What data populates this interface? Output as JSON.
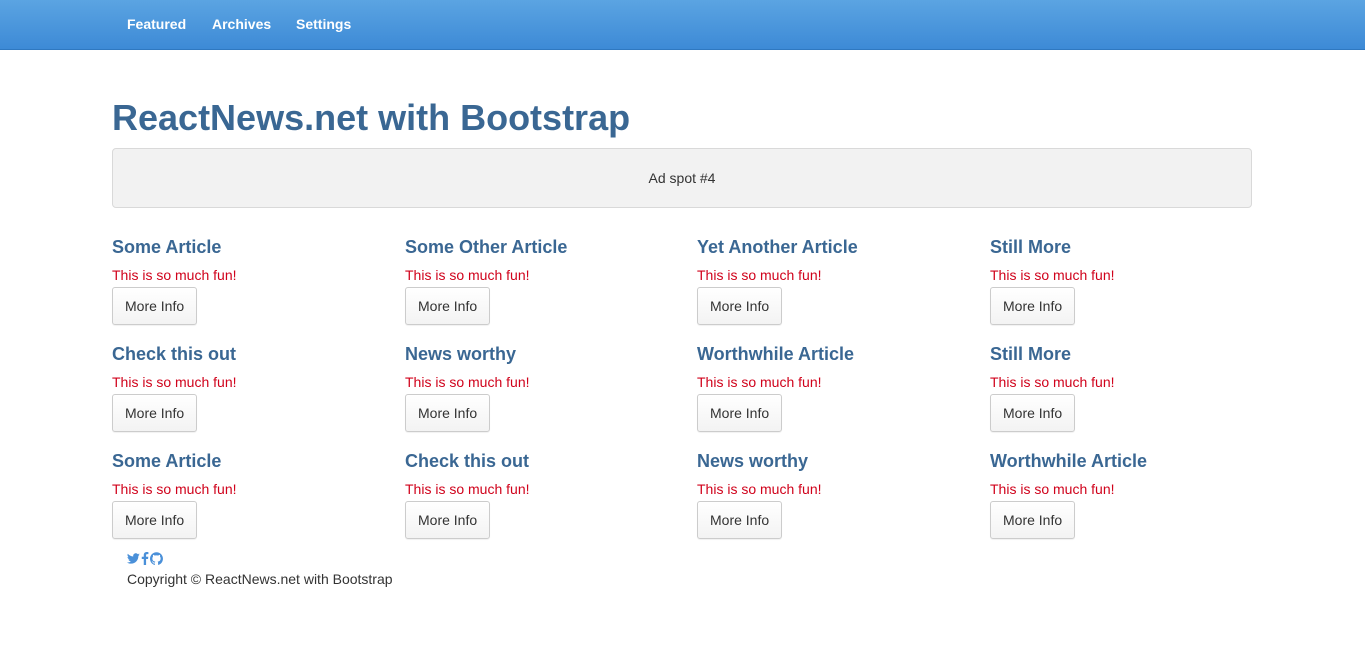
{
  "nav": {
    "items": [
      "Featured",
      "Archives",
      "Settings"
    ]
  },
  "header": {
    "title": "ReactNews.net with Bootstrap"
  },
  "ad": {
    "label": "Ad spot #4"
  },
  "articles": [
    {
      "title": "Some Article",
      "desc": "This is so much fun!",
      "button": "More Info"
    },
    {
      "title": "Some Other Article",
      "desc": "This is so much fun!",
      "button": "More Info"
    },
    {
      "title": "Yet Another Article",
      "desc": "This is so much fun!",
      "button": "More Info"
    },
    {
      "title": "Still More",
      "desc": "This is so much fun!",
      "button": "More Info"
    },
    {
      "title": "Check this out",
      "desc": "This is so much fun!",
      "button": "More Info"
    },
    {
      "title": "News worthy",
      "desc": "This is so much fun!",
      "button": "More Info"
    },
    {
      "title": "Worthwhile Article",
      "desc": "This is so much fun!",
      "button": "More Info"
    },
    {
      "title": "Still More",
      "desc": "This is so much fun!",
      "button": "More Info"
    },
    {
      "title": "Some Article",
      "desc": "This is so much fun!",
      "button": "More Info"
    },
    {
      "title": "Check this out",
      "desc": "This is so much fun!",
      "button": "More Info"
    },
    {
      "title": "News worthy",
      "desc": "This is so much fun!",
      "button": "More Info"
    },
    {
      "title": "Worthwhile Article",
      "desc": "This is so much fun!",
      "button": "More Info"
    }
  ],
  "footer": {
    "social_icons": [
      "twitter-icon",
      "facebook-icon",
      "github-icon"
    ],
    "icon_color": "#4a90d9",
    "copyright": "Copyright © ReactNews.net with Bootstrap"
  },
  "colors": {
    "navbar_top": "#5ba4e2",
    "navbar_bottom": "#3d8ad6",
    "heading": "#3a6793",
    "desc_text": "#d0021b",
    "ad_background": "#f2f2f2"
  }
}
